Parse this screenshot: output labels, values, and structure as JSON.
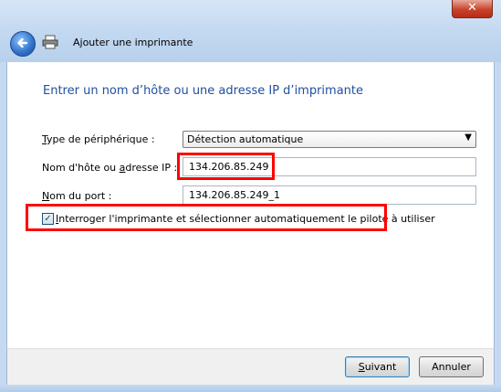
{
  "window": {
    "close_glyph": "✕"
  },
  "header": {
    "title": "Ajouter une imprimante",
    "back_icon": "back-arrow-icon",
    "app_icon": "printer-icon"
  },
  "main": {
    "heading": "Entrer un nom d’hôte ou une adresse IP d’imprimante",
    "device_type": {
      "label_pre": "T",
      "label_post": "ype de périphérique :",
      "value": "Détection automatique"
    },
    "hostname": {
      "label_pre": "Nom d'hôte ou ",
      "label_u": "a",
      "label_post": "dresse IP :",
      "value": "134.206.85.249"
    },
    "port": {
      "label_u": "N",
      "label_post": "om du port :",
      "value": "134.206.85.249_1"
    },
    "query_checkbox": {
      "checked": true,
      "check_glyph": "✓",
      "label_u": "I",
      "label_post": "nterroger l'imprimante et sélectionner automatiquement le pilote à utiliser"
    }
  },
  "footer": {
    "next_u": "S",
    "next_post": "uivant",
    "cancel": "Annuler"
  },
  "colors": {
    "highlight": "#ff0000",
    "heading": "#1f4fa0"
  }
}
